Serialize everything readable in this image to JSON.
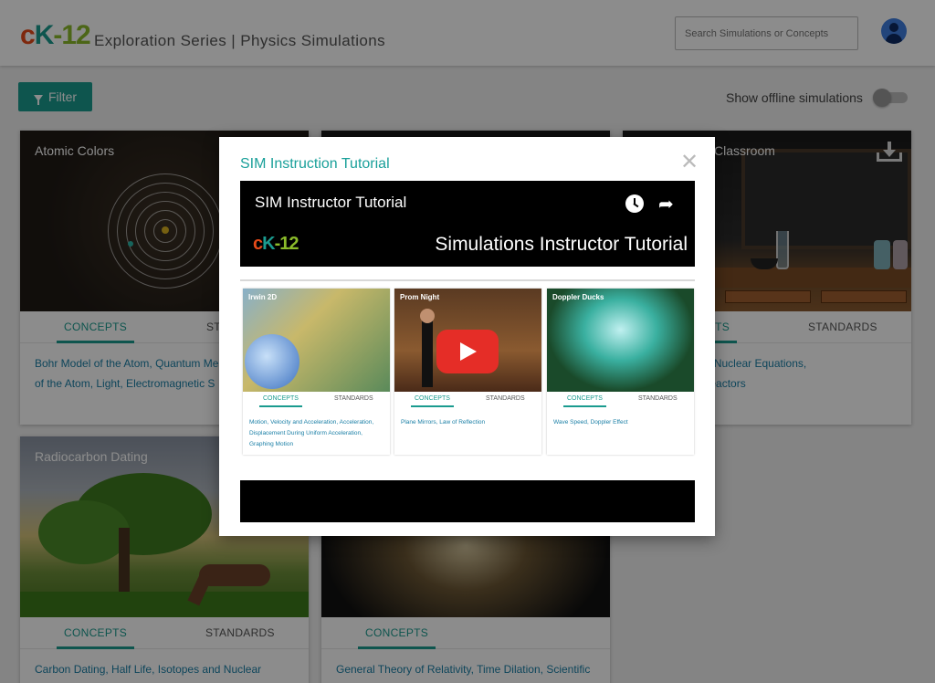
{
  "header": {
    "logo": {
      "c": "c",
      "k": "K",
      "n": "-12"
    },
    "title": "Exploration Series | Physics Simulations",
    "search_placeholder": "Search Simulations or Concepts"
  },
  "toolbar": {
    "filter_label": "Filter",
    "offline_label": "Show offline simulations",
    "offline_enabled": false
  },
  "cards": {
    "atomic": {
      "title": "Atomic Colors",
      "tab_concepts": "CONCEPTS",
      "tab_standards": "STANDARDS",
      "concepts_line1": "Bohr Model of the Atom, Quantum Me",
      "concepts_line2": "of the Atom, Light, Electromagnetic S"
    },
    "classroom": {
      "title": "Classroom",
      "tab_concepts": "CONCEPTS",
      "tab_standards": "STANDARDS",
      "concepts_line1": "uclear Stability, Nuclear Equations,",
      "concepts_line2": "Life, Nuclear Reactors"
    },
    "radiocarbon": {
      "title": "Radiocarbon Dating",
      "tab_concepts": "CONCEPTS",
      "tab_standards": "STANDARDS",
      "concepts_line1": "Carbon Dating, Half Life, Isotopes and Nuclear"
    },
    "relativity": {
      "tab_concepts": "CONCEPTS",
      "concepts_line1": "General Theory of Relativity, Time Dilation, Scientific"
    }
  },
  "modal": {
    "title": "SIM Instruction Tutorial",
    "video": {
      "title": "SIM Instructor Tutorial",
      "logo": "cK-12",
      "subtitle": "Simulations Instructor Tutorial",
      "cards": [
        {
          "name": "Irwin 2D",
          "tab1": "CONCEPTS",
          "tab2": "STANDARDS",
          "links": "Motion, Velocity and Acceleration, Acceleration, Displacement During Uniform Acceleration, Graphing Motion"
        },
        {
          "name": "Prom Night",
          "tab1": "CONCEPTS",
          "tab2": "STANDARDS",
          "links": "Plane Mirrors, Law of Reflection"
        },
        {
          "name": "Doppler Ducks",
          "tab1": "CONCEPTS",
          "tab2": "STANDARDS",
          "links": "Wave Speed, Doppler Effect"
        }
      ]
    }
  },
  "colors": {
    "accent": "#1a9b8f",
    "link": "#1a7fa6",
    "play": "#e52d27"
  }
}
